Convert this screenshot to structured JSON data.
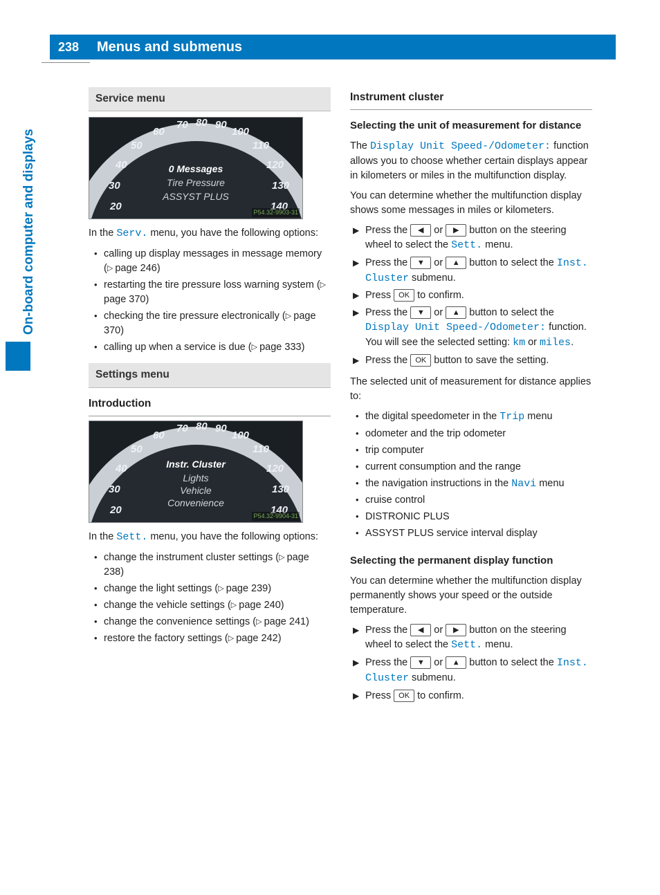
{
  "page_number": "238",
  "page_title": "Menus and submenus",
  "side_tab": "On-board computer and displays",
  "left": {
    "service": {
      "head": "Service menu",
      "gauge": {
        "ticks": [
          "20",
          "30",
          "40",
          "50",
          "60",
          "70",
          "80",
          "90",
          "100",
          "110",
          "120",
          "130",
          "140"
        ],
        "lines": [
          "0 Messages",
          "Tire Pressure",
          "ASSYST PLUS"
        ],
        "code": "P54.32-9903-31"
      },
      "intro_pre": "In the ",
      "intro_disp": "Serv.",
      "intro_post": " menu, you have the following options:",
      "bullets": [
        {
          "t": "calling up display messages in message memory (",
          "ref": "page 246",
          "t2": ")"
        },
        {
          "t": "restarting the tire pressure loss warning system (",
          "ref": "page 370",
          "t2": ")"
        },
        {
          "t": "checking the tire pressure electronically (",
          "ref": "page 370",
          "t2": ")"
        },
        {
          "t": "calling up when a service is due (",
          "ref": "page 333",
          "t2": ")"
        }
      ]
    },
    "settings": {
      "head": "Settings menu",
      "sub": "Introduction",
      "gauge": {
        "ticks": [
          "20",
          "30",
          "40",
          "50",
          "60",
          "70",
          "80",
          "90",
          "100",
          "110",
          "120",
          "130",
          "140"
        ],
        "lines": [
          "Instr. Cluster",
          "Lights",
          "Vehicle",
          "Convenience"
        ],
        "code": "P54.32-9904-31"
      },
      "intro_pre": "In the ",
      "intro_disp": "Sett.",
      "intro_post": " menu, you have the following options:",
      "bullets": [
        {
          "t": "change the instrument cluster settings (",
          "ref": "page 238",
          "t2": ")"
        },
        {
          "t": "change the light settings (",
          "ref": "page 239",
          "t2": ")"
        },
        {
          "t": "change the vehicle settings (",
          "ref": "page 240",
          "t2": ")"
        },
        {
          "t": "change the convenience settings (",
          "ref": "page 241",
          "t2": ")"
        },
        {
          "t": "restore the factory settings (",
          "ref": "page 242",
          "t2": ")"
        }
      ]
    }
  },
  "right": {
    "ic_head": "Instrument cluster",
    "unit": {
      "head": "Selecting the unit of measurement for distance",
      "p1_pre": "The ",
      "p1_disp": "Display Unit Speed-/Odometer:",
      "p1_post": " function allows you to choose whether certain displays appear in kilometers or miles in the multifunction display.",
      "p2": "You can determine whether the multifunction display shows some messages in miles or kilometers.",
      "steps": {
        "s1_a": "Press the ",
        "s1_b": " or ",
        "s1_c": " button on the steering wheel to select the ",
        "s1_disp": "Sett.",
        "s1_d": " menu.",
        "s2_a": "Press the ",
        "s2_b": " or ",
        "s2_c": " button to select the ",
        "s2_disp": "Inst. Cluster",
        "s2_d": " submenu.",
        "s3_a": "Press ",
        "s3_b": " to confirm.",
        "s4_a": "Press the ",
        "s4_b": " or ",
        "s4_c": " button to select the ",
        "s4_disp": "Display Unit Speed-/Odometer:",
        "s4_d": " function.",
        "s4_e": "You will see the selected setting: ",
        "s4_km": "km",
        "s4_f": " or ",
        "s4_mi": "miles",
        "s4_g": ".",
        "s5_a": "Press the ",
        "s5_b": " button to save the setting."
      },
      "applies_intro": "The selected unit of measurement for distance applies to:",
      "applies": [
        {
          "pre": "the digital speedometer in the ",
          "disp": "Trip",
          "post": " menu"
        },
        {
          "pre": "odometer and the trip odometer",
          "disp": "",
          "post": ""
        },
        {
          "pre": "trip computer",
          "disp": "",
          "post": ""
        },
        {
          "pre": "current consumption and the range",
          "disp": "",
          "post": ""
        },
        {
          "pre": "the navigation instructions in the ",
          "disp": "Navi",
          "post": " menu"
        },
        {
          "pre": "cruise control",
          "disp": "",
          "post": ""
        },
        {
          "pre": "DISTRONIC PLUS",
          "disp": "",
          "post": ""
        },
        {
          "pre": "ASSYST PLUS service interval display",
          "disp": "",
          "post": ""
        }
      ]
    },
    "perm": {
      "head": "Selecting the permanent display function",
      "p1": "You can determine whether the multifunction display permanently shows your speed or the outside temperature.",
      "steps": {
        "s1_a": "Press the ",
        "s1_b": " or ",
        "s1_c": " button on the steering wheel to select the ",
        "s1_disp": "Sett.",
        "s1_d": " menu.",
        "s2_a": "Press the ",
        "s2_b": " or ",
        "s2_c": " button to select the ",
        "s2_disp": "Inst. Cluster",
        "s2_d": " submenu.",
        "s3_a": "Press ",
        "s3_b": " to confirm."
      }
    }
  },
  "keys": {
    "left": "◀",
    "right": "▶",
    "up": "▲",
    "down": "▼",
    "ok": "OK"
  }
}
